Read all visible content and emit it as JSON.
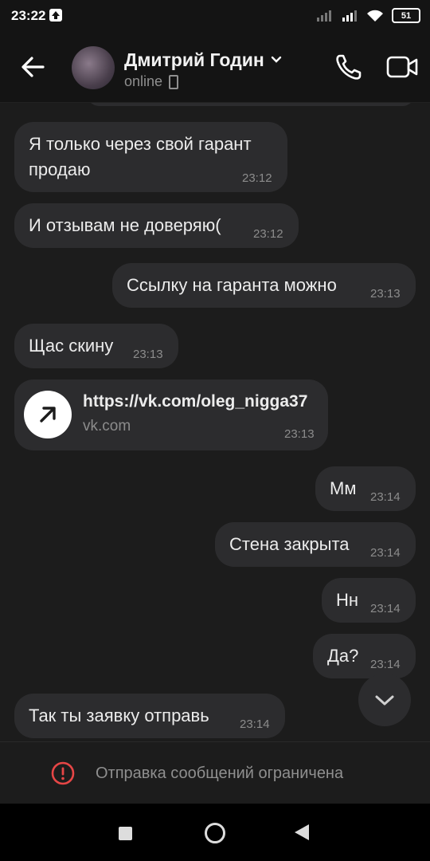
{
  "status_bar": {
    "time": "23:22",
    "battery": "51"
  },
  "header": {
    "contact_name": "Дмитрий Годин",
    "status": "online"
  },
  "messages": [
    {
      "side": "in",
      "text": "Я только через свой гарант\nпродаю",
      "time": "23:12"
    },
    {
      "side": "in",
      "text": "И отзывам не доверяю(",
      "time": "23:12"
    },
    {
      "side": "out",
      "text": "Ссылку на гаранта можно",
      "time": "23:13"
    },
    {
      "side": "in",
      "text": "Щас скину",
      "time": "23:13"
    },
    {
      "side": "in",
      "type": "link",
      "url": "https://vk.com/oleg_nigga37",
      "domain": "vk.com",
      "time": "23:13"
    },
    {
      "side": "out",
      "text": "Мм",
      "time": "23:14"
    },
    {
      "side": "out",
      "text": "Стена закрыта",
      "time": "23:14"
    },
    {
      "side": "out",
      "text": "Нн",
      "time": "23:14"
    },
    {
      "side": "out",
      "text": "Да?",
      "time": "23:14"
    },
    {
      "side": "in",
      "text": "Так ты заявку отправь",
      "time": "23:14"
    }
  ],
  "composer": {
    "restricted_text": "Отправка сообщений ограничена"
  },
  "icons": {
    "back": "arrow-left-icon",
    "call": "phone-icon",
    "video": "video-camera-icon",
    "link": "external-link-arrow-icon",
    "scroll": "chevron-down-icon",
    "warning": "exclamation-circle-icon"
  },
  "colors": {
    "background": "#1c1c1c",
    "bubble": "#2c2c2e",
    "warning": "#e64646"
  }
}
